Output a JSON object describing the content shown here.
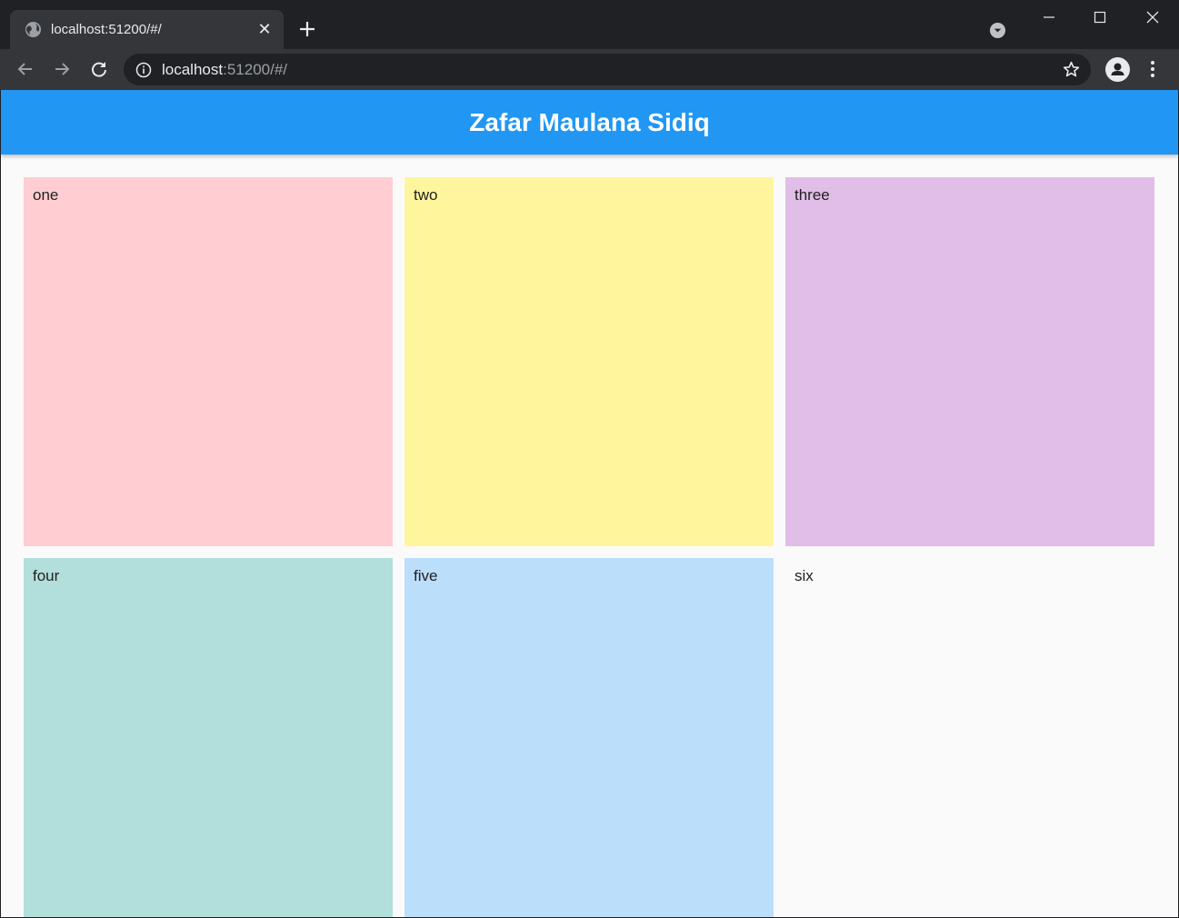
{
  "browser": {
    "tab_title": "localhost:51200/#/",
    "url_host": "localhost",
    "url_rest": ":51200/#/"
  },
  "app": {
    "title": "Zafar Maulana Sidiq",
    "accent_color": "#2196f3"
  },
  "grid": {
    "cells": [
      {
        "label": "one",
        "color": "#ffcdd2"
      },
      {
        "label": "two",
        "color": "#fff59d"
      },
      {
        "label": "three",
        "color": "#e1bee7"
      },
      {
        "label": "four",
        "color": "#b2dfdb"
      },
      {
        "label": "five",
        "color": "#bbdefb"
      },
      {
        "label": "six",
        "color": "#fafafa"
      }
    ]
  }
}
